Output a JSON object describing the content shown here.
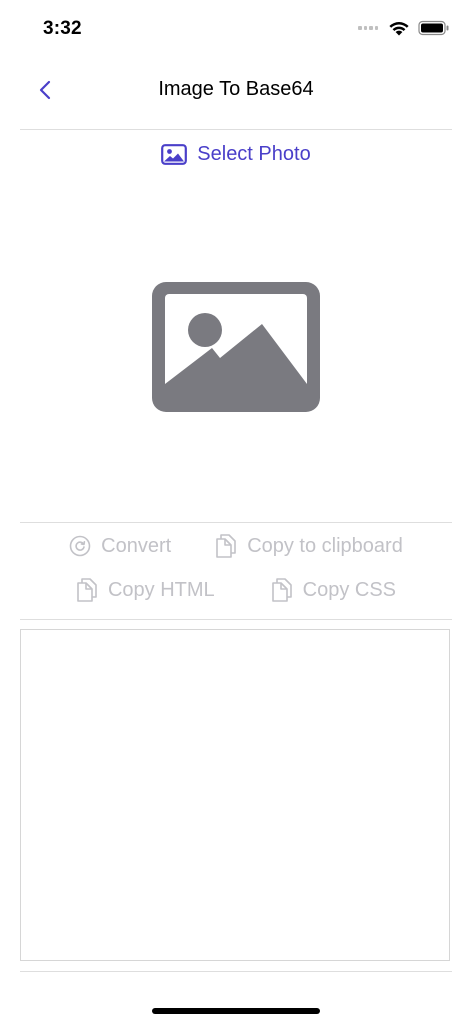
{
  "status_bar": {
    "time": "3:32"
  },
  "nav": {
    "title": "Image To Base64"
  },
  "select_photo": {
    "label": "Select Photo"
  },
  "actions": {
    "convert": "Convert",
    "copy_clipboard": "Copy to clipboard",
    "copy_html": "Copy HTML",
    "copy_css": "Copy CSS"
  },
  "output": {
    "value": ""
  },
  "colors": {
    "accent": "#4a3fc9",
    "disabled": "#c2c2c7",
    "placeholder_icon": "#7a7a80"
  }
}
